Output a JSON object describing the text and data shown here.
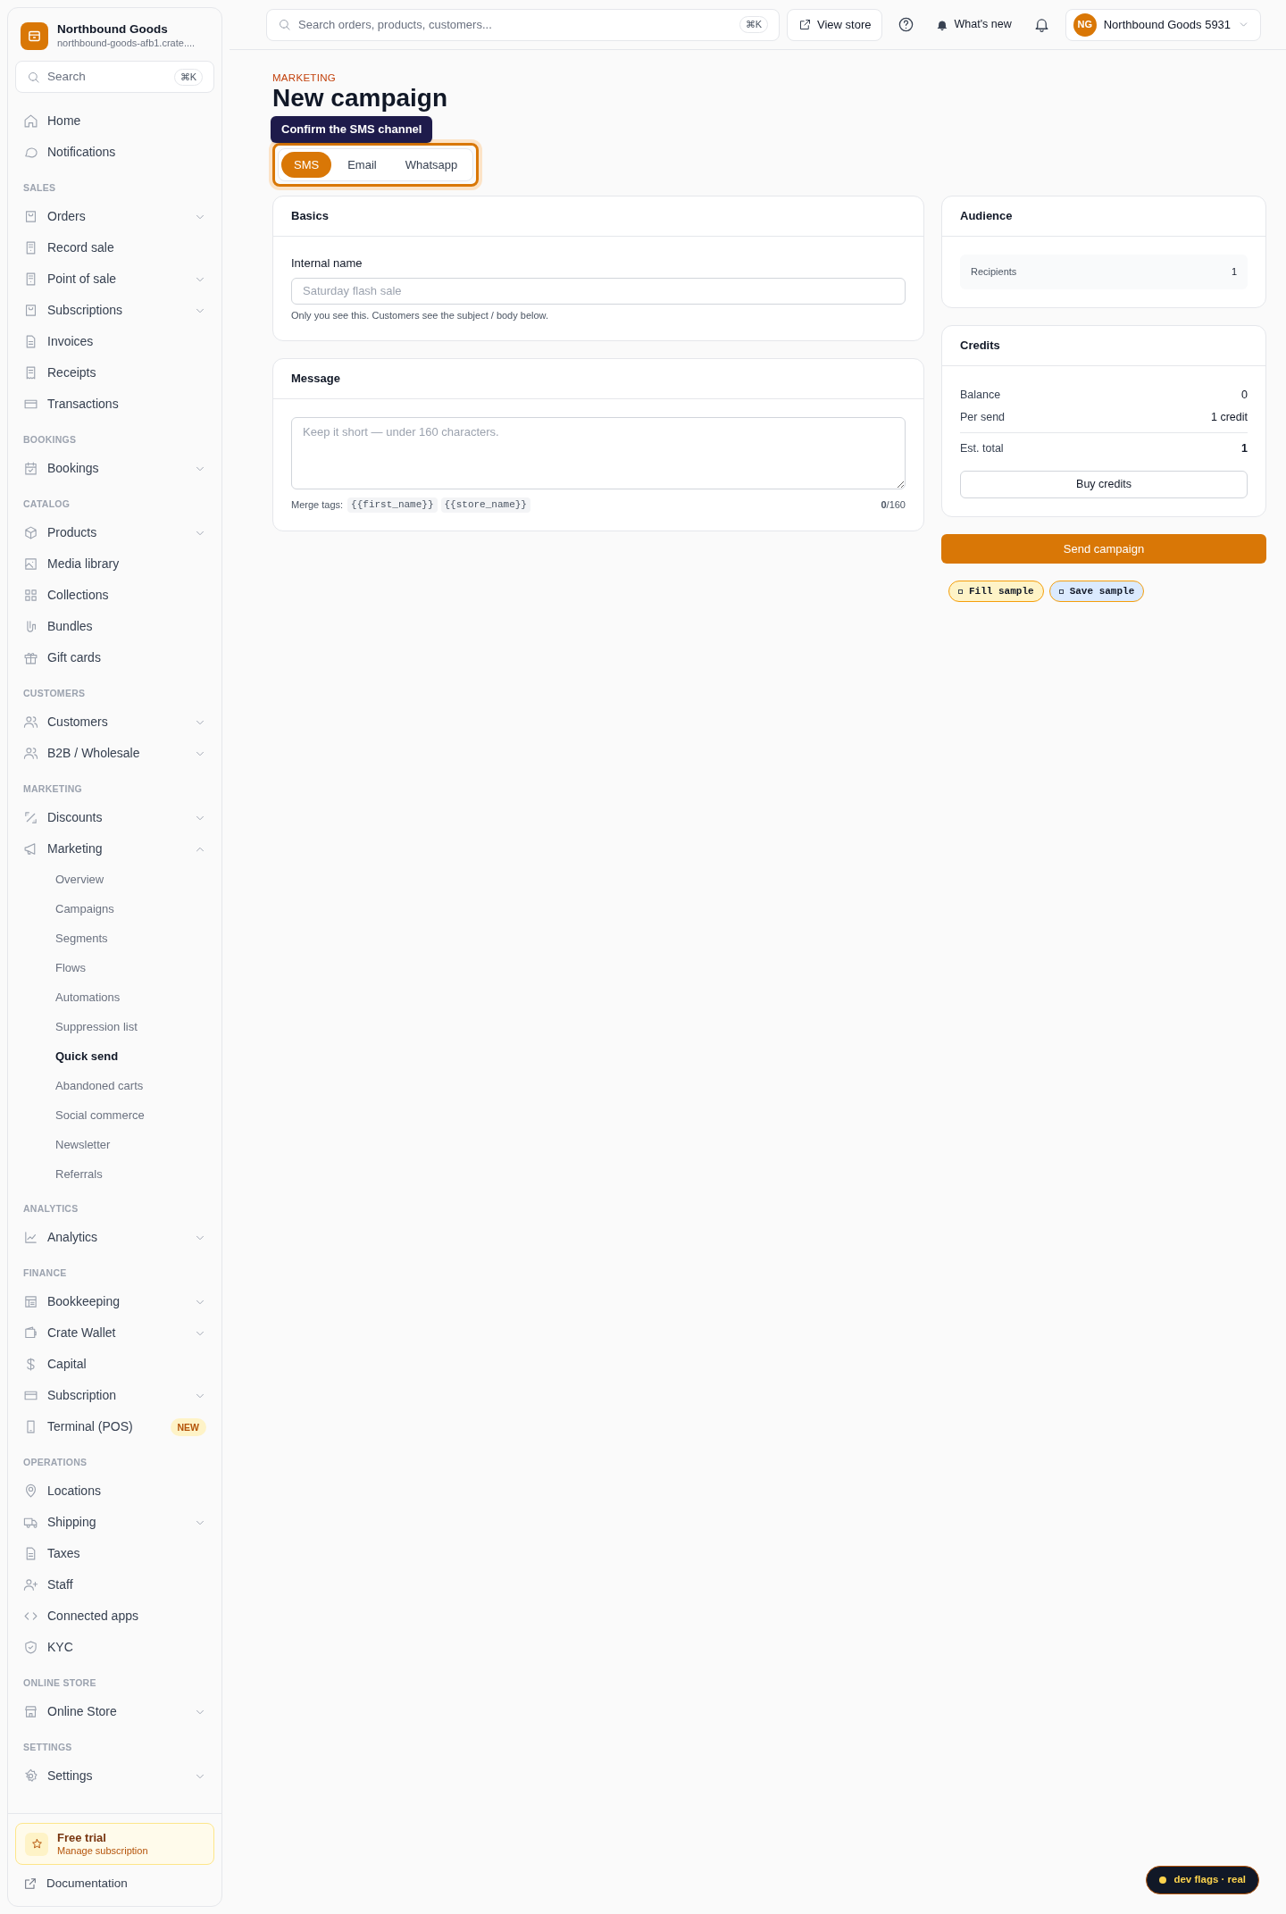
{
  "sidebar": {
    "brand": {
      "name": "Northbound Goods",
      "domain": "northbound-goods-afb1.crate...."
    },
    "search": {
      "placeholder": "Search",
      "shortcut": "⌘K"
    },
    "sections": [
      {
        "items": [
          {
            "label": "Home",
            "kind": "link"
          },
          {
            "label": "Notifications",
            "kind": "link"
          }
        ]
      },
      {
        "title": "SALES",
        "items": [
          {
            "label": "Orders",
            "kind": "menu",
            "expanded": false
          },
          {
            "label": "Record sale",
            "kind": "link"
          },
          {
            "label": "Point of sale",
            "kind": "menu",
            "expanded": false
          },
          {
            "label": "Subscriptions",
            "kind": "menu",
            "expanded": false
          },
          {
            "label": "Invoices",
            "kind": "link"
          },
          {
            "label": "Receipts",
            "kind": "link"
          },
          {
            "label": "Transactions",
            "kind": "link"
          }
        ]
      },
      {
        "title": "BOOKINGS",
        "items": [
          {
            "label": "Bookings",
            "kind": "menu",
            "expanded": false
          }
        ]
      },
      {
        "title": "CATALOG",
        "items": [
          {
            "label": "Products",
            "kind": "menu",
            "expanded": false
          },
          {
            "label": "Media library",
            "kind": "link"
          },
          {
            "label": "Collections",
            "kind": "link"
          },
          {
            "label": "Bundles",
            "kind": "link"
          },
          {
            "label": "Gift cards",
            "kind": "link"
          }
        ]
      },
      {
        "title": "CUSTOMERS",
        "items": [
          {
            "label": "Customers",
            "kind": "menu",
            "expanded": false
          },
          {
            "label": "B2B / Wholesale",
            "kind": "menu",
            "expanded": false
          }
        ]
      },
      {
        "title": "MARKETING",
        "items": [
          {
            "label": "Discounts",
            "kind": "menu",
            "expanded": false
          },
          {
            "label": "Marketing",
            "kind": "menu",
            "expanded": true,
            "children": [
              {
                "label": "Overview",
                "selected": false
              },
              {
                "label": "Campaigns",
                "selected": false
              },
              {
                "label": "Segments",
                "selected": false
              },
              {
                "label": "Flows",
                "selected": false
              },
              {
                "label": "Automations",
                "selected": false
              },
              {
                "label": "Suppression list",
                "selected": false
              },
              {
                "label": "Quick send",
                "selected": true
              },
              {
                "label": "Abandoned carts",
                "selected": false
              },
              {
                "label": "Social commerce",
                "selected": false
              },
              {
                "label": "Newsletter",
                "selected": false
              },
              {
                "label": "Referrals",
                "selected": false
              }
            ]
          }
        ]
      },
      {
        "title": "ANALYTICS",
        "items": [
          {
            "label": "Analytics",
            "kind": "menu",
            "expanded": false
          }
        ]
      },
      {
        "title": "FINANCE",
        "items": [
          {
            "label": "Bookkeeping",
            "kind": "menu",
            "expanded": false
          },
          {
            "label": "Crate Wallet",
            "kind": "menu",
            "expanded": false
          },
          {
            "label": "Capital",
            "kind": "link"
          },
          {
            "label": "Subscription",
            "kind": "menu",
            "expanded": false
          },
          {
            "label": "Terminal (POS)",
            "kind": "link",
            "badge": "NEW"
          }
        ]
      },
      {
        "title": "OPERATIONS",
        "items": [
          {
            "label": "Locations",
            "kind": "link"
          },
          {
            "label": "Shipping",
            "kind": "menu",
            "expanded": false
          },
          {
            "label": "Taxes",
            "kind": "link"
          },
          {
            "label": "Staff",
            "kind": "link"
          },
          {
            "label": "Connected apps",
            "kind": "link"
          },
          {
            "label": "KYC",
            "kind": "link"
          }
        ]
      },
      {
        "title": "ONLINE STORE",
        "items": [
          {
            "label": "Online Store",
            "kind": "menu",
            "expanded": false
          }
        ]
      },
      {
        "title": "SETTINGS",
        "items": [
          {
            "label": "Settings",
            "kind": "menu",
            "expanded": false
          }
        ]
      }
    ],
    "trial": {
      "title": "Free trial",
      "link": "Manage subscription"
    },
    "footer_link": "Documentation"
  },
  "topbar": {
    "search": {
      "placeholder": "Search orders, products, customers...",
      "shortcut": "⌘K"
    },
    "view_store": "View store",
    "whats_new": "What's new",
    "account": {
      "initials": "NG",
      "name": "Northbound Goods 5931"
    }
  },
  "page": {
    "eyebrow": "MARKETING",
    "title": "New campaign",
    "tooltip": "Confirm the SMS channel",
    "tabs": [
      {
        "label": "SMS",
        "selected": true
      },
      {
        "label": "Email",
        "selected": false
      },
      {
        "label": "Whatsapp",
        "selected": false
      }
    ],
    "basics": {
      "title": "Basics",
      "field_label": "Internal name",
      "placeholder": "Saturday flash sale",
      "help": "Only you see this. Customers see the subject / body below."
    },
    "message": {
      "title": "Message",
      "placeholder": "Keep it short — under 160 characters.",
      "merge_label": "Merge tags:",
      "merge_tags": [
        "{{first_name}}",
        "{{store_name}}"
      ],
      "counter": "**0**/160"
    },
    "audience": {
      "title": "Audience",
      "label": "Recipients",
      "value": "1"
    },
    "credits": {
      "title": "Credits",
      "rows": [
        {
          "label": "Balance",
          "value": "0",
          "kind": "line"
        },
        {
          "label": "Per send",
          "value": "1 credit",
          "kind": "line"
        },
        {
          "label": "Est. total",
          "value": "1",
          "kind": "total"
        }
      ],
      "button": "Buy credits"
    },
    "send_button": "Send campaign",
    "samples": [
      {
        "label": "Fill sample",
        "color": "#fef3c7"
      },
      {
        "label": "Save sample",
        "color": "#dbeafe"
      }
    ]
  },
  "dev_badge": "dev flags · real"
}
